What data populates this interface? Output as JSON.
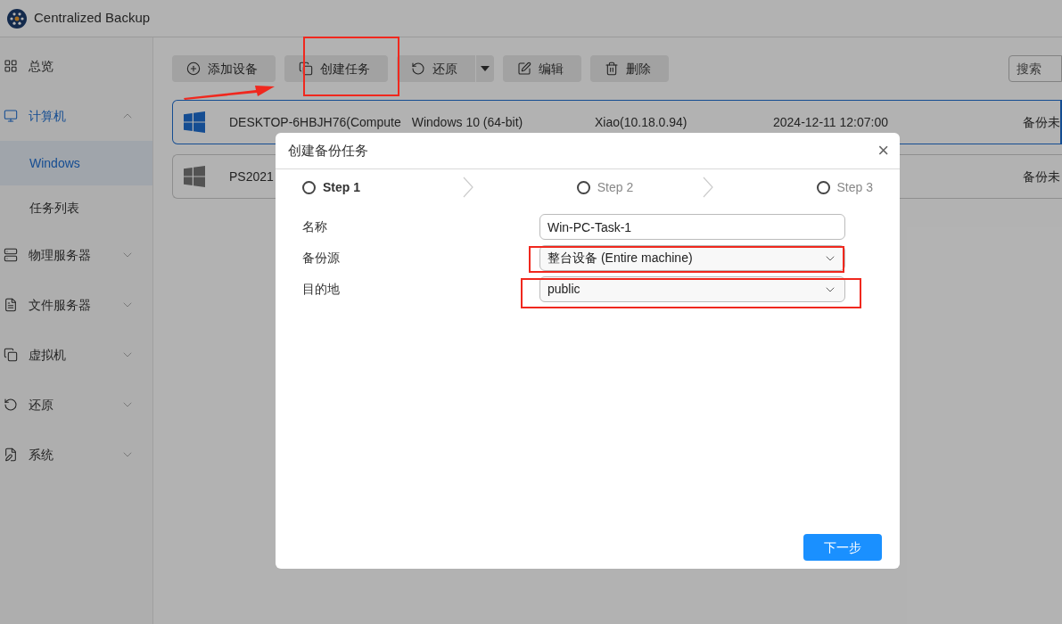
{
  "app": {
    "title": "Centralized Backup"
  },
  "sidebar": {
    "items": [
      {
        "label": "总览",
        "kind": "link",
        "selected": false
      },
      {
        "label": "计算机",
        "kind": "group",
        "expanded": true,
        "selected": true,
        "children": [
          {
            "label": "Windows",
            "selected": true
          },
          {
            "label": "任务列表",
            "selected": false
          }
        ]
      },
      {
        "label": "物理服务器",
        "kind": "group",
        "expanded": false,
        "selected": false
      },
      {
        "label": "文件服务器",
        "kind": "group",
        "expanded": false,
        "selected": false
      },
      {
        "label": "虚拟机",
        "kind": "group",
        "expanded": false,
        "selected": false
      },
      {
        "label": "还原",
        "kind": "group",
        "expanded": false,
        "selected": false
      },
      {
        "label": "系统",
        "kind": "group",
        "expanded": false,
        "selected": false
      }
    ]
  },
  "toolbar": {
    "buttons": [
      {
        "label": "添加设备",
        "kind": "plain"
      },
      {
        "label": "创建任务",
        "kind": "plain"
      },
      {
        "label": "还原",
        "kind": "split"
      },
      {
        "label": "编辑",
        "kind": "plain"
      },
      {
        "label": "删除",
        "kind": "plain"
      }
    ],
    "search": {
      "placeholder": "搜索"
    }
  },
  "devices": [
    {
      "name": "DESKTOP-6HBJH76(Compute",
      "os": "Windows 10 (64-bit)",
      "user": "Xiao(10.18.0.94)",
      "time": "2024-12-11 12:07:00",
      "status": "备份未",
      "selected": true
    },
    {
      "name": "PS2021",
      "status": "备份未",
      "selected": false
    }
  ],
  "dialog": {
    "title": "创建备份任务",
    "close": "×",
    "steps": [
      {
        "label": "Step 1",
        "active": true
      },
      {
        "label": "Step 2",
        "active": false
      },
      {
        "label": "Step 3",
        "active": false
      }
    ],
    "fields": [
      {
        "label": "名称",
        "kind": "text",
        "value": "Win-PC-Task-1"
      },
      {
        "label": "备份源",
        "kind": "select",
        "value": "整台设备 (Entire machine)"
      },
      {
        "label": "目的地",
        "kind": "select",
        "value": "public"
      }
    ],
    "next_button": "下一步"
  }
}
